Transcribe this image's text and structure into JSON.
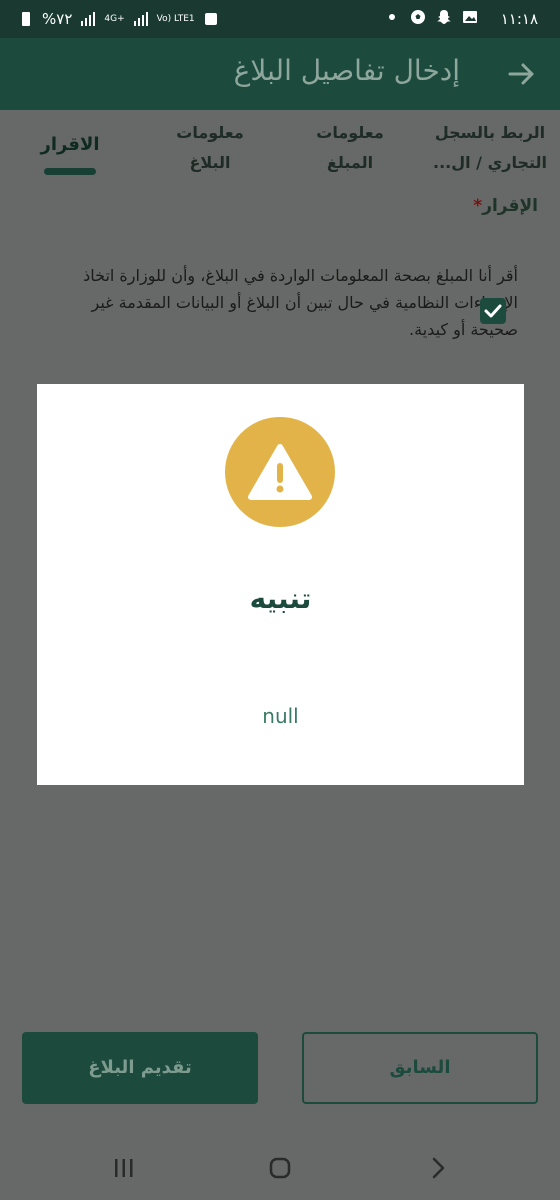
{
  "status_bar": {
    "time": "١١:١٨",
    "battery": "%٧٢",
    "network_labels": [
      "4G+",
      "Vo) LTE1"
    ]
  },
  "app_bar": {
    "title": "إدخال تفاصيل البلاغ",
    "back_icon": "arrow-right-icon"
  },
  "tabs": [
    {
      "label_line1": "الربط بالسجل",
      "label_line2": "التجاري / ال...",
      "active": false
    },
    {
      "label_line1": "معلومات",
      "label_line2": "المبلغ",
      "active": false
    },
    {
      "label_line1": "معلومات",
      "label_line2": "البلاغ",
      "active": false
    },
    {
      "label_line1": "الاقرار",
      "label_line2": "",
      "active": true
    }
  ],
  "declaration": {
    "section_label": "الإقرار",
    "required_mark": "*",
    "text": "أقر أنا المبلغ بصحة المعلومات الواردة في البلاغ، وأن للوزارة اتخاذ الإجراءات النظامية في حال تبين أن البلاغ أو البيانات المقدمة غير صحيحة أو كيدية.",
    "checked": true
  },
  "dialog": {
    "icon": "warning-icon",
    "title": "تنبيه",
    "message": "null"
  },
  "buttons": {
    "submit": "تقديم البلاغ",
    "previous": "السابق"
  },
  "colors": {
    "primary": "#1c4b3e",
    "warning": "#e2b349",
    "overlay": "#666967"
  }
}
